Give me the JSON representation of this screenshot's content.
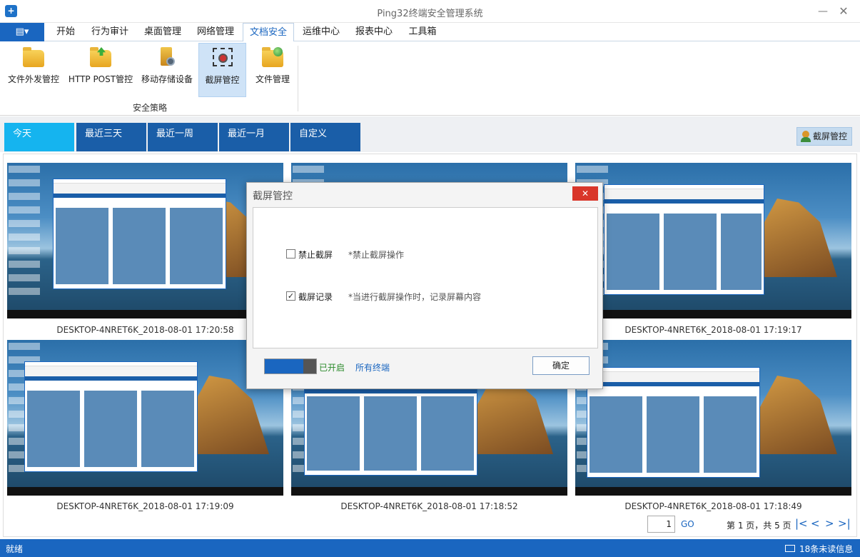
{
  "window": {
    "title": "Ping32终端安全管理系统",
    "minimize": "—",
    "maximize": "☐",
    "close": "✕"
  },
  "menu": {
    "app_button": "▤▾",
    "tabs": [
      "开始",
      "行为审计",
      "桌面管理",
      "网络管理",
      "文档安全",
      "运维中心",
      "报表中心",
      "工具箱"
    ],
    "active_tab": "文档安全"
  },
  "ribbon": {
    "buttons": [
      "文件外发管控",
      "HTTP POST管控",
      "移动存储设备",
      "截屏管控",
      "文件管理"
    ],
    "active": "截屏管控",
    "group_label": "安全策略"
  },
  "filter": {
    "tabs": [
      "今天",
      "最近三天",
      "最近一周",
      "最近一月",
      "自定义"
    ],
    "active": "今天",
    "right_button": "截屏管控"
  },
  "gallery": {
    "captions": [
      "DESKTOP-4NRET6K_2018-08-01 17:20:58",
      "DESKTOP-4NRET6K_2018-08-01 17:19:17",
      "DESKTOP-4NRET6K_2018-08-01 17:19:09",
      "DESKTOP-4NRET6K_2018-08-01 17:18:52",
      "DESKTOP-4NRET6K_2018-08-01 17:18:49"
    ]
  },
  "pager": {
    "page_input": "1",
    "go": "GO",
    "info": "第 1 页，共 5 页",
    "first": "|<",
    "prev": "<",
    "next": ">",
    "last": ">|"
  },
  "dialog": {
    "title": "截屏管控",
    "close": "✕",
    "options": [
      {
        "label": "禁止截屏",
        "hint": "*禁止截屏操作",
        "checked": false
      },
      {
        "label": "截屏记录",
        "hint": "*当进行截屏操作时，记录屏幕内容",
        "checked": true
      }
    ],
    "status_label": "已开启",
    "scope_label": "所有终端",
    "ok_button": "确定"
  },
  "status": {
    "left": "就绪",
    "right": "18条未读信息"
  },
  "colors": {
    "accent": "#1a66c0",
    "active_tab": "#15b4ef",
    "close_red": "#d9362a"
  }
}
